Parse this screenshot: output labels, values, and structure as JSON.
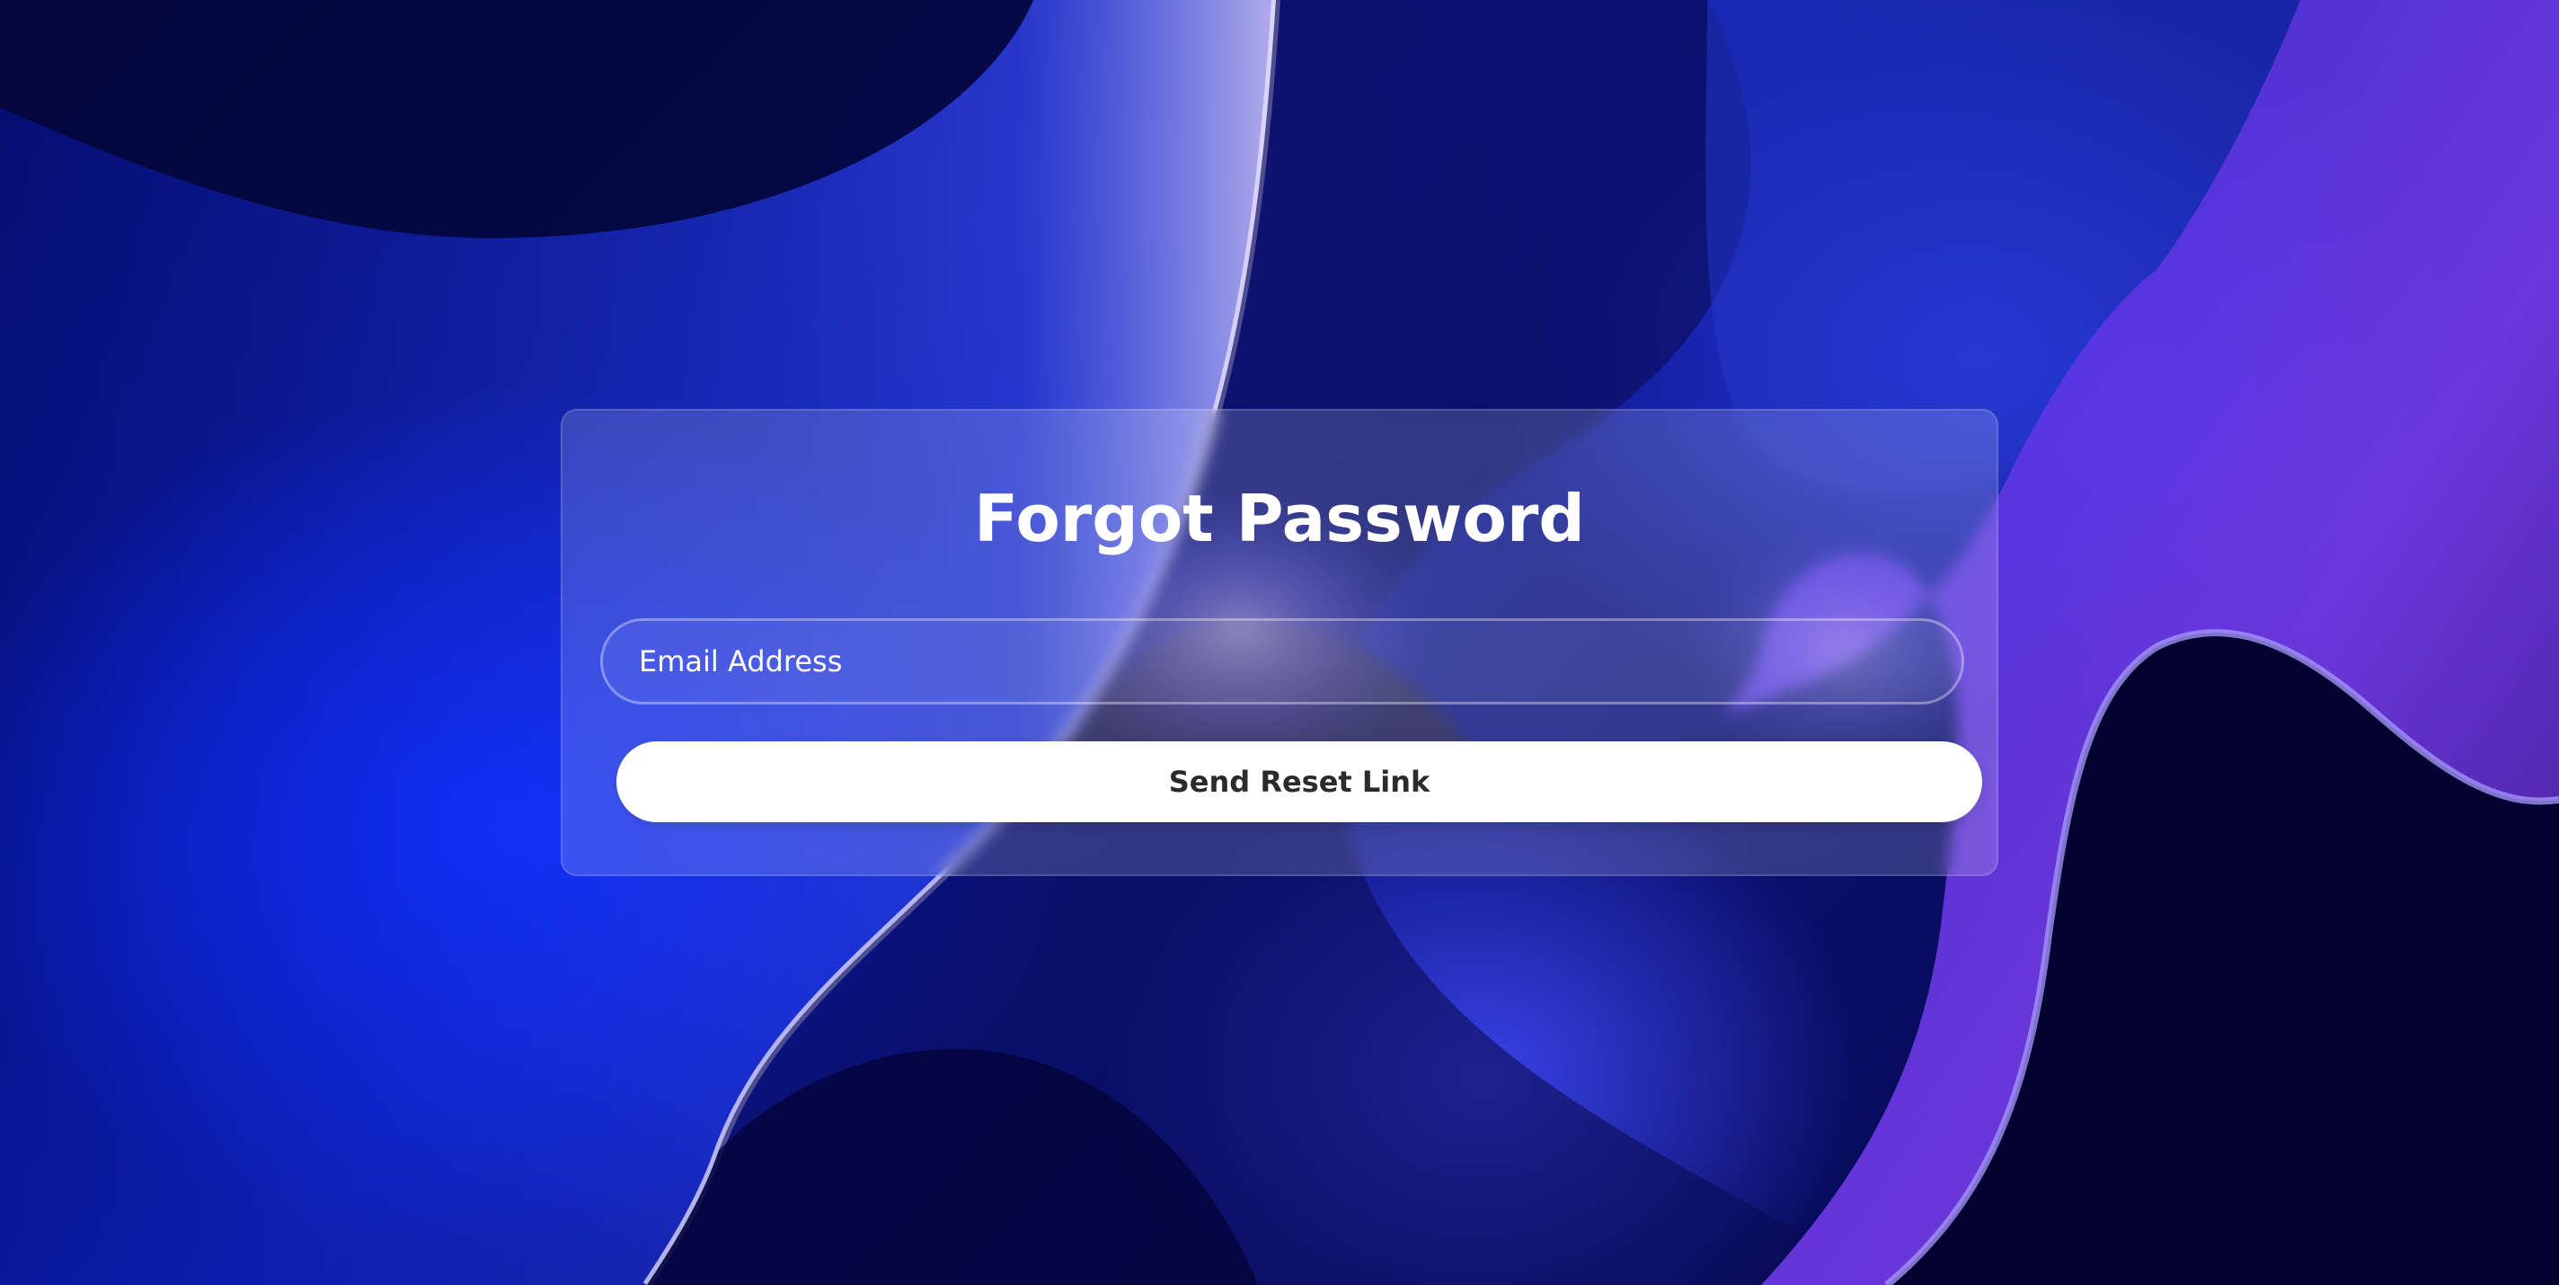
{
  "form": {
    "title": "Forgot Password",
    "email_placeholder": "Email Address",
    "submit_label": "Send Reset Link"
  },
  "colors": {
    "background_dark": "#04063a",
    "background_blue": "#0a2bff",
    "accent_violet": "#8a5cf0",
    "button_bg": "#ffffff",
    "button_text": "#2b2b2b"
  }
}
